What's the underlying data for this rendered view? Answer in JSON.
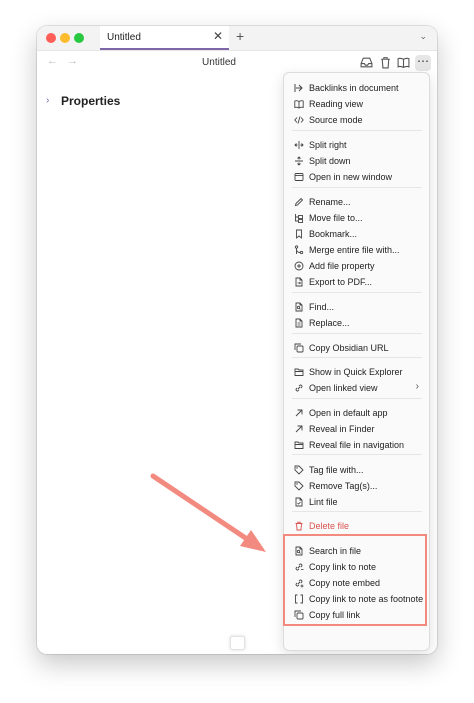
{
  "window": {
    "tab_title": "Untitled",
    "tab_close": "✕",
    "new_tab": "+",
    "tab_list": "⌄"
  },
  "navbar": {
    "back": "←",
    "forward": "→",
    "title": "Untitled",
    "more": "⋯"
  },
  "properties": {
    "chevron": "›",
    "label": "Properties"
  },
  "menu": {
    "items": [
      {
        "label": "Backlinks in document",
        "icon": "backlinks-icon"
      },
      {
        "label": "Reading view",
        "icon": "book-open-icon"
      },
      {
        "label": "Source mode",
        "icon": "code-icon"
      },
      {
        "label": "Split right",
        "icon": "split-right-icon"
      },
      {
        "label": "Split down",
        "icon": "split-down-icon"
      },
      {
        "label": "Open in new window",
        "icon": "new-window-icon"
      },
      {
        "label": "Rename...",
        "icon": "pencil-icon"
      },
      {
        "label": "Move file to...",
        "icon": "folder-tree-icon"
      },
      {
        "label": "Bookmark...",
        "icon": "bookmark-icon"
      },
      {
        "label": "Merge entire file with...",
        "icon": "git-merge-icon"
      },
      {
        "label": "Add file property",
        "icon": "plus-circle-icon"
      },
      {
        "label": "Export to PDF...",
        "icon": "file-export-icon"
      },
      {
        "label": "Find...",
        "icon": "file-search-icon"
      },
      {
        "label": "Replace...",
        "icon": "file-replace-icon"
      },
      {
        "label": "Copy Obsidian URL",
        "icon": "copy-icon"
      },
      {
        "label": "Show in Quick Explorer",
        "icon": "folder-open-icon"
      },
      {
        "label": "Open linked view",
        "icon": "link-icon",
        "arrow": "›"
      },
      {
        "label": "Open in default app",
        "icon": "arrow-up-right-icon"
      },
      {
        "label": "Reveal in Finder",
        "icon": "arrow-up-right-icon"
      },
      {
        "label": "Reveal file in navigation",
        "icon": "folder-open-icon"
      },
      {
        "label": "Tag file with...",
        "icon": "tag-icon"
      },
      {
        "label": "Remove Tag(s)...",
        "icon": "tag-icon"
      },
      {
        "label": "Lint file",
        "icon": "lint-icon"
      },
      {
        "label": "Delete file",
        "icon": "trash-icon"
      },
      {
        "label": "Search in file",
        "icon": "file-search-icon"
      },
      {
        "label": "Copy link to note",
        "icon": "link-copy-icon"
      },
      {
        "label": "Copy note embed",
        "icon": "embed-icon"
      },
      {
        "label": "Copy link to note as footnote",
        "icon": "brackets-icon"
      },
      {
        "label": "Copy full link",
        "icon": "copy-icon"
      }
    ]
  },
  "colors": {
    "accent": "#7d67a8",
    "danger": "#d9534f",
    "annotation": "#f38a80"
  }
}
